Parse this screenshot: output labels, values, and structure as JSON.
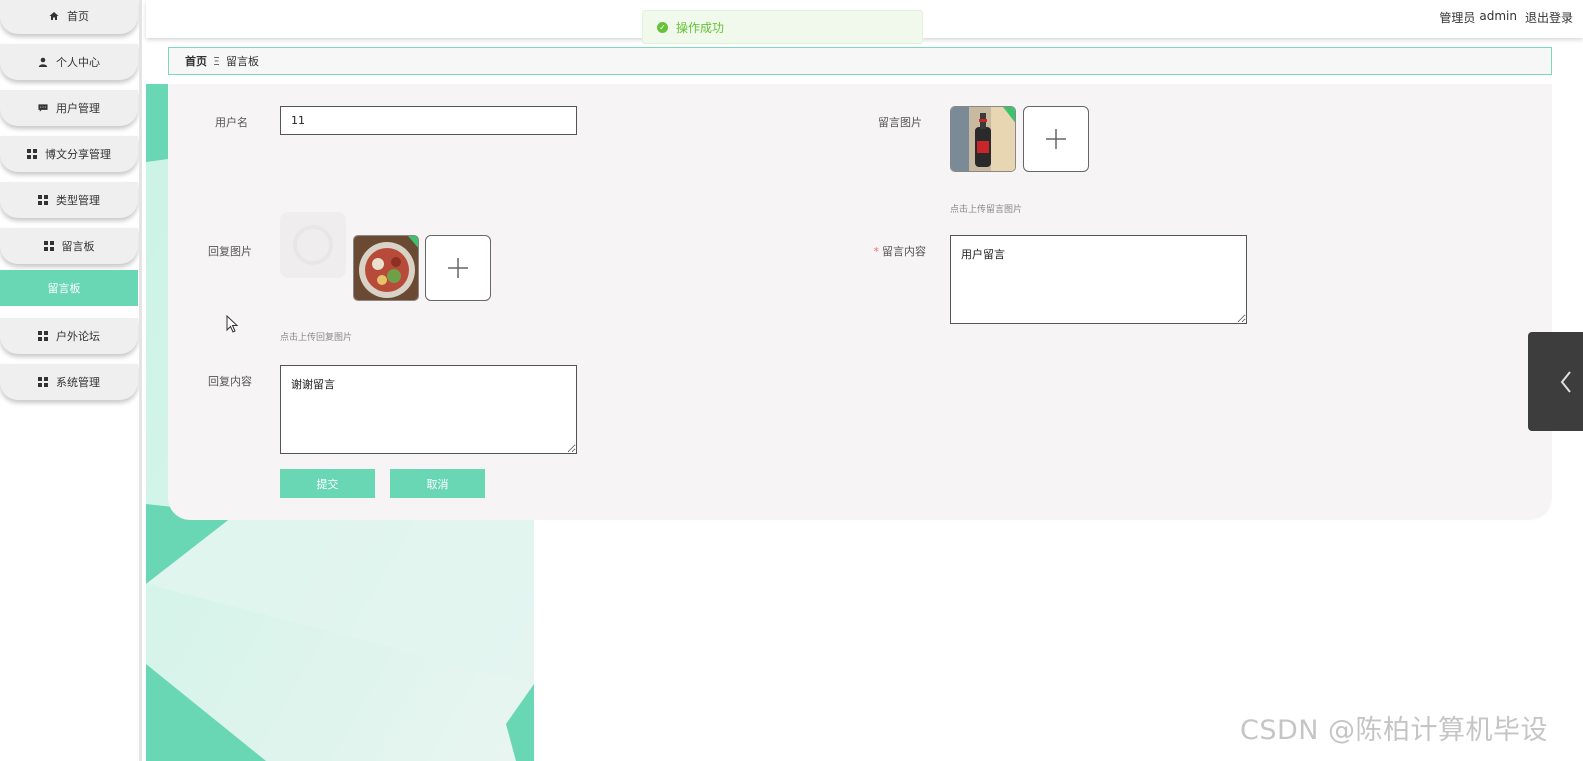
{
  "sidebar": {
    "items": [
      {
        "label": "首页",
        "icon": "home-icon"
      },
      {
        "label": "个人中心",
        "icon": "user-icon"
      },
      {
        "label": "用户管理",
        "icon": "message-icon"
      },
      {
        "label": "博文分享管理",
        "icon": "grid-icon"
      },
      {
        "label": "类型管理",
        "icon": "grid-icon"
      },
      {
        "label": "留言板",
        "icon": "grid-icon"
      },
      {
        "label": "户外论坛",
        "icon": "grid-icon"
      },
      {
        "label": "系统管理",
        "icon": "grid-icon"
      }
    ],
    "active_submenu": "留言板"
  },
  "header": {
    "role": "管理员",
    "username": "admin",
    "logout": "退出登录"
  },
  "toast": {
    "message": "操作成功",
    "type": "success"
  },
  "breadcrumb": {
    "home": "首页",
    "separator": "Ξ",
    "current": "留言板"
  },
  "form": {
    "username_label": "用户名",
    "username_value": "11",
    "message_image_label": "留言图片",
    "message_image_hint": "点击上传留言图片",
    "reply_image_label": "回复图片",
    "reply_image_hint": "点击上传回复图片",
    "message_content_label": "留言内容",
    "message_content_required": "*",
    "message_content_value": "用户留言",
    "reply_content_label": "回复内容",
    "reply_content_value": "谢谢留言",
    "submit_label": "提交",
    "cancel_label": "取消"
  },
  "watermark": "CSDN @陈柏计算机毕设",
  "colors": {
    "accent": "#69d6b4",
    "success": "#67c23a",
    "panel_bg": "#f7f4f5",
    "drawer": "#3d3d3d"
  }
}
